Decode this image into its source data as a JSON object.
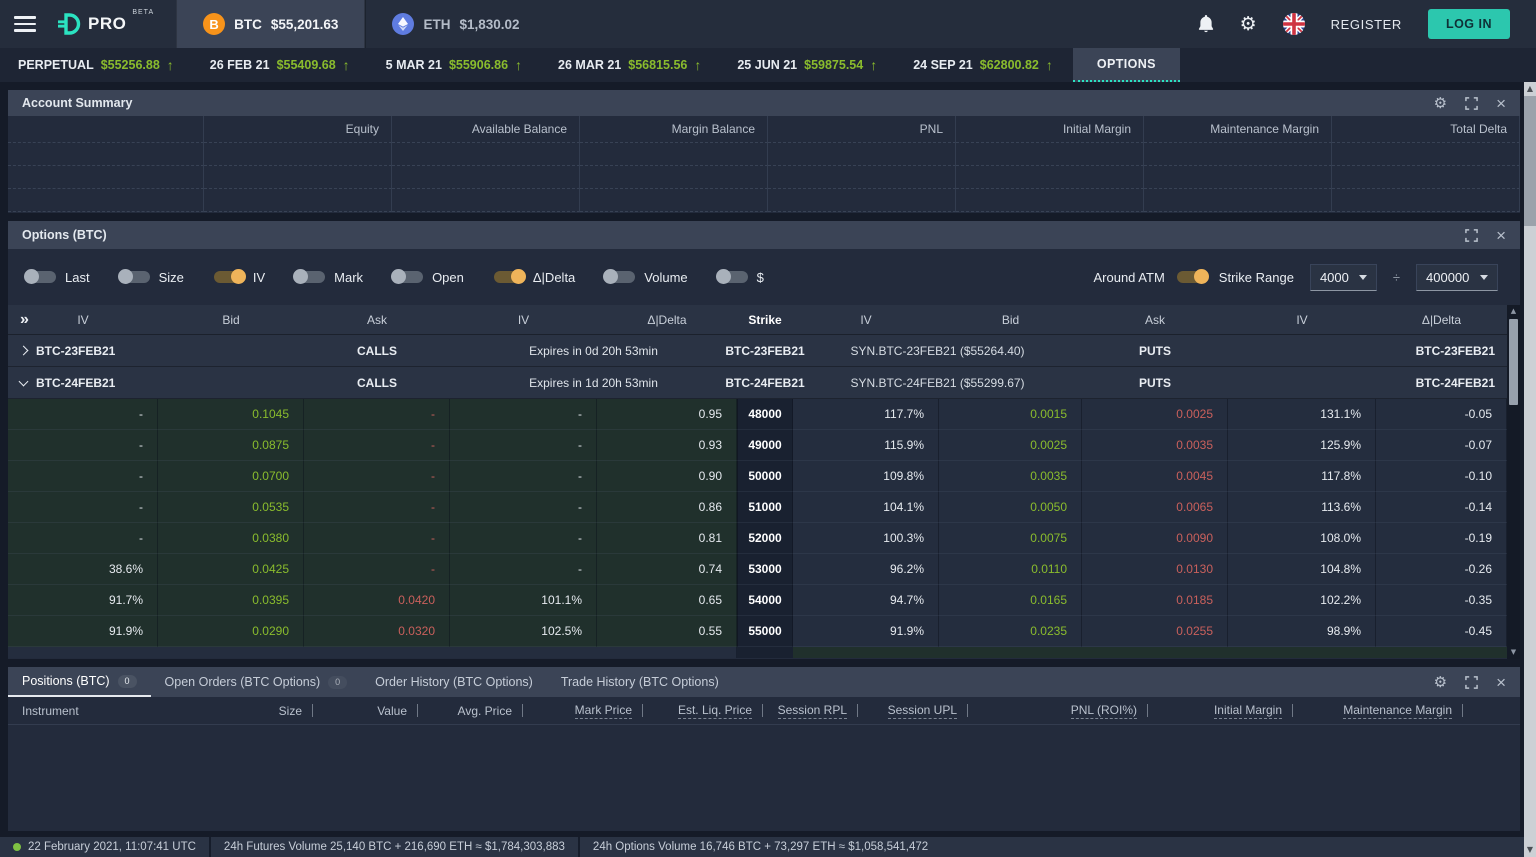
{
  "topbar": {
    "brand": "PRO",
    "beta": "BETA",
    "instruments": [
      {
        "symbol": "BTC",
        "price": "$55,201.63"
      },
      {
        "symbol": "ETH",
        "price": "$1,830.02"
      }
    ],
    "register_label": "REGISTER",
    "login_label": "LOG IN"
  },
  "futures_nav": {
    "items": [
      {
        "label": "PERPETUAL",
        "price": "$55256.88"
      },
      {
        "label": "26 FEB 21",
        "price": "$55409.68"
      },
      {
        "label": "5 MAR 21",
        "price": "$55906.86"
      },
      {
        "label": "26 MAR 21",
        "price": "$56815.56"
      },
      {
        "label": "25 JUN 21",
        "price": "$59875.54"
      },
      {
        "label": "24 SEP 21",
        "price": "$62800.82"
      }
    ],
    "options_tab": "OPTIONS"
  },
  "account_summary": {
    "title": "Account Summary",
    "columns": [
      "",
      "Equity",
      "Available Balance",
      "Margin Balance",
      "PNL",
      "Initial Margin",
      "Maintenance Margin",
      "Total Delta"
    ],
    "empty_rows": 3
  },
  "options_panel": {
    "title": "Options (BTC)",
    "toggles": [
      {
        "label": "Last",
        "on": false
      },
      {
        "label": "Size",
        "on": false
      },
      {
        "label": "IV",
        "on": true
      },
      {
        "label": "Mark",
        "on": false
      },
      {
        "label": "Open",
        "on": false
      },
      {
        "label": "Δ|Delta",
        "on": true
      },
      {
        "label": "Volume",
        "on": false
      },
      {
        "label": "$",
        "on": false
      }
    ],
    "around_atm_label": "Around ATM",
    "around_atm_on": true,
    "strike_range_label": "Strike Range",
    "strike_min": "4000",
    "divider": "÷",
    "strike_max": "400000",
    "header": [
      "IV",
      "Bid",
      "Ask",
      "IV",
      "Δ|Delta",
      "Strike",
      "IV",
      "Bid",
      "Ask",
      "IV",
      "Δ|Delta"
    ],
    "groups": [
      {
        "name": "BTC-23FEB21",
        "expanded": false,
        "calls_label": "CALLS",
        "expires": "Expires in 0d 20h 53min",
        "strike_label": "BTC-23FEB21",
        "syn": "SYN.BTC-23FEB21 ($55264.40)",
        "puts_label": "PUTS",
        "right_label": "BTC-23FEB21"
      },
      {
        "name": "BTC-24FEB21",
        "expanded": true,
        "calls_label": "CALLS",
        "expires": "Expires in 1d 20h 53min",
        "strike_label": "BTC-24FEB21",
        "syn": "SYN.BTC-24FEB21 ($55299.67)",
        "puts_label": "PUTS",
        "right_label": "BTC-24FEB21"
      }
    ],
    "rows": [
      {
        "c_iv1": "-",
        "c_bid": "0.1045",
        "c_ask": "-",
        "c_iv2": "-",
        "c_delta": "0.95",
        "strike": "48000",
        "p_iv1": "117.7%",
        "p_bid": "0.0015",
        "p_ask": "0.0025",
        "p_iv2": "131.1%",
        "p_delta": "-0.05"
      },
      {
        "c_iv1": "-",
        "c_bid": "0.0875",
        "c_ask": "-",
        "c_iv2": "-",
        "c_delta": "0.93",
        "strike": "49000",
        "p_iv1": "115.9%",
        "p_bid": "0.0025",
        "p_ask": "0.0035",
        "p_iv2": "125.9%",
        "p_delta": "-0.07"
      },
      {
        "c_iv1": "-",
        "c_bid": "0.0700",
        "c_ask": "-",
        "c_iv2": "-",
        "c_delta": "0.90",
        "strike": "50000",
        "p_iv1": "109.8%",
        "p_bid": "0.0035",
        "p_ask": "0.0045",
        "p_iv2": "117.8%",
        "p_delta": "-0.10"
      },
      {
        "c_iv1": "-",
        "c_bid": "0.0535",
        "c_ask": "-",
        "c_iv2": "-",
        "c_delta": "0.86",
        "strike": "51000",
        "p_iv1": "104.1%",
        "p_bid": "0.0050",
        "p_ask": "0.0065",
        "p_iv2": "113.6%",
        "p_delta": "-0.14"
      },
      {
        "c_iv1": "-",
        "c_bid": "0.0380",
        "c_ask": "-",
        "c_iv2": "-",
        "c_delta": "0.81",
        "strike": "52000",
        "p_iv1": "100.3%",
        "p_bid": "0.0075",
        "p_ask": "0.0090",
        "p_iv2": "108.0%",
        "p_delta": "-0.19"
      },
      {
        "c_iv1": "38.6%",
        "c_bid": "0.0425",
        "c_ask": "-",
        "c_iv2": "-",
        "c_delta": "0.74",
        "strike": "53000",
        "p_iv1": "96.2%",
        "p_bid": "0.0110",
        "p_ask": "0.0130",
        "p_iv2": "104.8%",
        "p_delta": "-0.26"
      },
      {
        "c_iv1": "91.7%",
        "c_bid": "0.0395",
        "c_ask": "0.0420",
        "c_iv2": "101.1%",
        "c_delta": "0.65",
        "strike": "54000",
        "p_iv1": "94.7%",
        "p_bid": "0.0165",
        "p_ask": "0.0185",
        "p_iv2": "102.2%",
        "p_delta": "-0.35"
      },
      {
        "c_iv1": "91.9%",
        "c_bid": "0.0290",
        "c_ask": "0.0320",
        "c_iv2": "102.5%",
        "c_delta": "0.55",
        "strike": "55000",
        "p_iv1": "91.9%",
        "p_bid": "0.0235",
        "p_ask": "0.0255",
        "p_iv2": "98.9%",
        "p_delta": "-0.45"
      }
    ]
  },
  "positions_panel": {
    "tabs": [
      {
        "label": "Positions (BTC)",
        "badge": "0",
        "active": true
      },
      {
        "label": "Open Orders (BTC Options)",
        "badge": "0",
        "active": false
      },
      {
        "label": "Order History (BTC Options)",
        "active": false
      },
      {
        "label": "Trade History (BTC Options)",
        "active": false
      }
    ],
    "columns": [
      {
        "label": "Instrument",
        "u": false
      },
      {
        "label": "Size",
        "u": false
      },
      {
        "label": "Value",
        "u": false
      },
      {
        "label": "Avg. Price",
        "u": false
      },
      {
        "label": "Mark Price",
        "u": true
      },
      {
        "label": "Est. Liq. Price",
        "u": true
      },
      {
        "label": "Session RPL",
        "u": true
      },
      {
        "label": "Session UPL",
        "u": true
      },
      {
        "label": "PNL (ROI%)",
        "u": true
      },
      {
        "label": "Initial Margin",
        "u": true
      },
      {
        "label": "Maintenance Margin",
        "u": true
      }
    ]
  },
  "statusbar": {
    "time": "22 February 2021, 11:07:41 UTC",
    "futures_volume": "24h Futures Volume 25,140 BTC + 216,690 ETH ≈ $1,784,303,883",
    "options_volume": "24h Options Volume 16,746 BTC + 73,297 ETH ≈ $1,058,541,472"
  }
}
